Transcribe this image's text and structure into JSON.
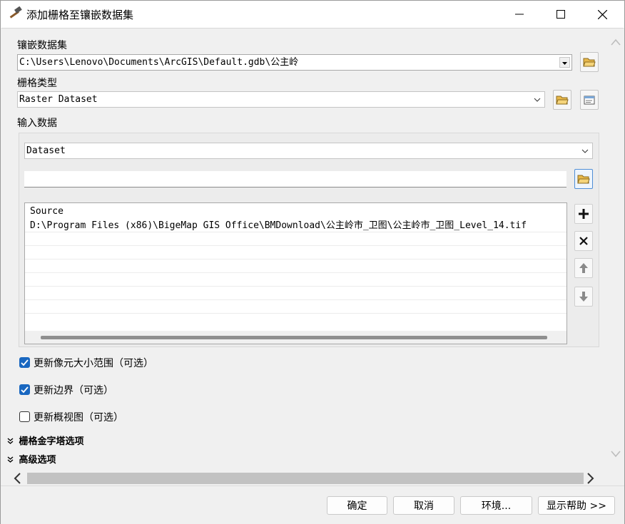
{
  "window": {
    "title": "添加栅格至镶嵌数据集",
    "app_icon": "hammer-icon"
  },
  "mosaic": {
    "label": "镶嵌数据集",
    "value": "C:\\Users\\Lenovo\\Documents\\ArcGIS\\Default.gdb\\公主岭"
  },
  "raster_type": {
    "label": "栅格类型",
    "value": "Raster Dataset"
  },
  "input": {
    "label": "输入数据",
    "type_value": "Dataset",
    "path_value": "",
    "list_header": "Source",
    "rows": [
      "D:\\Program Files (x86)\\BigeMap GIS Office\\BMDownload\\公主岭市_卫图\\公主岭市_卫图_Level_14.tif",
      "",
      "",
      "",
      "",
      "",
      ""
    ]
  },
  "options": [
    {
      "label": "更新像元大小范围（可选）",
      "checked": true
    },
    {
      "label": "更新边界（可选）",
      "checked": true
    },
    {
      "label": "更新概视图（可选）",
      "checked": false
    }
  ],
  "sections": [
    {
      "label": "栅格金字塔选项"
    },
    {
      "label": "高级选项"
    }
  ],
  "footer": {
    "ok": "确定",
    "cancel": "取消",
    "env": "环境...",
    "help": "显示帮助 >>"
  },
  "colors": {
    "accent": "#1967c0",
    "folder": "#e8b84a"
  }
}
